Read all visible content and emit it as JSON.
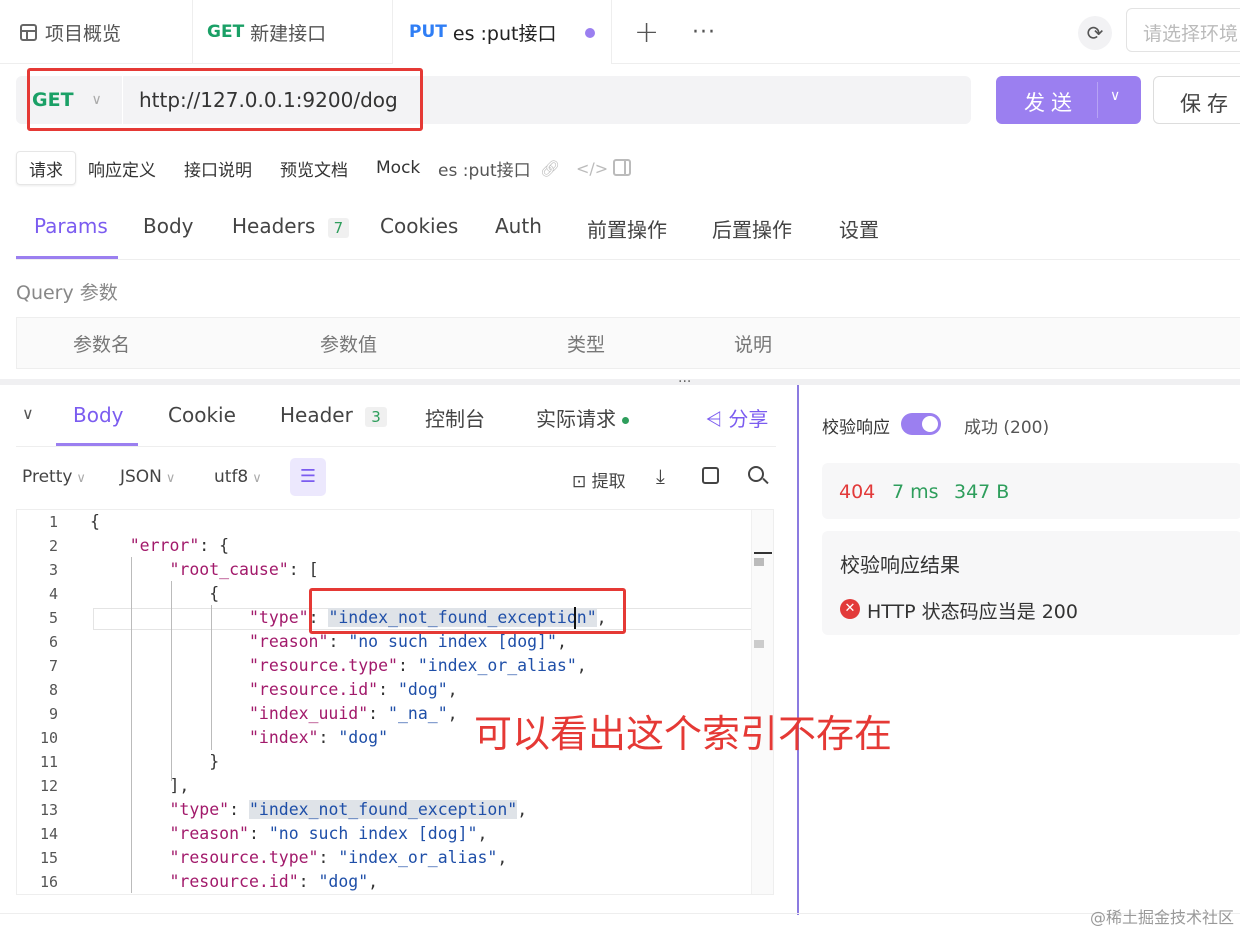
{
  "tabs": {
    "overview": "项目概览",
    "t1": {
      "method": "GET",
      "name": "新建接口"
    },
    "t2": {
      "method": "PUT",
      "name": "es :put接口"
    },
    "env_placeholder": "请选择环境"
  },
  "request": {
    "method": "GET",
    "url": "http://127.0.0.1:9200/dog",
    "send": "发送",
    "save": "保存"
  },
  "subtabs": [
    "请求",
    "响应定义",
    "接口说明",
    "预览文档",
    "Mock"
  ],
  "api_name": "es :put接口",
  "param_tabs": [
    "Params",
    "Body",
    "Headers",
    "Cookies",
    "Auth",
    "前置操作",
    "后置操作",
    "设置"
  ],
  "headers_count": "7",
  "query_label": "Query 参数",
  "table_headers": [
    "参数名",
    "参数值",
    "类型",
    "说明"
  ],
  "resp_tabs": [
    "Body",
    "Cookie",
    "Header",
    "控制台",
    "实际请求"
  ],
  "header_count": "3",
  "share": "分享",
  "format": {
    "pretty": "Pretty",
    "json": "JSON",
    "enc": "utf8",
    "extract": "提取"
  },
  "lines": [
    "1",
    "2",
    "3",
    "4",
    "5",
    "6",
    "7",
    "8",
    "9",
    "10",
    "11",
    "12",
    "13",
    "14",
    "15",
    "16"
  ],
  "json": {
    "l1": "{",
    "error": "\"error\"",
    "root_cause": "\"root_cause\"",
    "type_k": "\"type\"",
    "type_v": "\"index_not_found_exception\"",
    "reason_k": "\"reason\"",
    "reason_v": "\"no such index [dog]\"",
    "rtype_k": "\"resource.type\"",
    "rtype_v": "\"index_or_alias\"",
    "rid_k": "\"resource.id\"",
    "rid_v": "\"dog\"",
    "uuid_k": "\"index_uuid\"",
    "uuid_v": "\"_na_\"",
    "index_k": "\"index\"",
    "index_v": "\"dog\""
  },
  "annotation": "可以看出这个索引不存在",
  "validate": {
    "label": "校验响应",
    "status": "成功 (200)",
    "code": "404",
    "time": "7 ms",
    "size": "347 B",
    "result_title": "校验响应结果",
    "result_msg": "HTTP 状态码应当是 200"
  },
  "watermark": "@稀土掘金技术社区",
  "colors": {
    "accent": "#7b5cf0",
    "get": "#1aa066",
    "put": "#2f7ef5",
    "error": "#e23a3a",
    "success": "#2e9e5c"
  }
}
